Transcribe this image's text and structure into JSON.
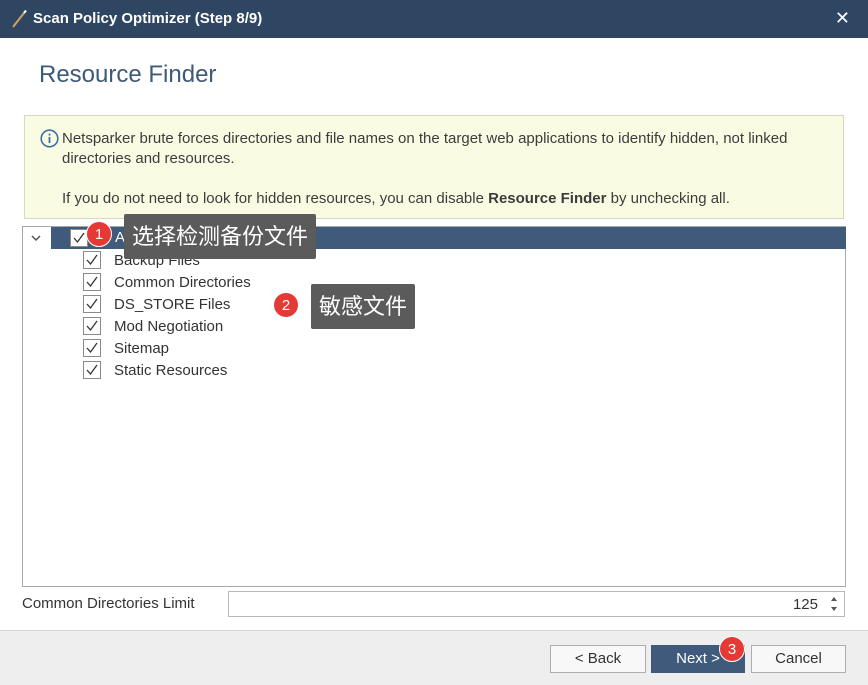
{
  "window": {
    "title": "Scan Policy Optimizer (Step 8/9)",
    "close_glyph": "✕"
  },
  "page": {
    "heading": "Resource Finder"
  },
  "info": {
    "icon": "info-icon",
    "line1": "Netsparker brute forces directories and file names on the target web applications to identify hidden, not linked directories and resources.",
    "line2_prefix": "If you do not need to look for hidden resources, you can disable ",
    "line2_bold": "Resource Finder",
    "line2_suffix": " by unchecking all."
  },
  "tree": {
    "root": {
      "label": "All",
      "checked": true
    },
    "items": [
      {
        "label": "Backup Files",
        "checked": true
      },
      {
        "label": "Common Directories",
        "checked": true
      },
      {
        "label": "DS_STORE Files",
        "checked": true
      },
      {
        "label": "Mod Negotiation",
        "checked": true
      },
      {
        "label": "Sitemap",
        "checked": true
      },
      {
        "label": "Static Resources",
        "checked": true
      }
    ]
  },
  "annotations": [
    {
      "badge": "1",
      "text": "选择检测备份文件"
    },
    {
      "badge": "2",
      "text": "敏感文件"
    },
    {
      "badge": "3"
    }
  ],
  "limit": {
    "label": "Common Directories Limit",
    "value": "125"
  },
  "buttons": {
    "back_label": "< Back",
    "next_label": "Next >",
    "cancel_label": "Cancel"
  },
  "colors": {
    "titlebar": "#2f4663",
    "accent": "#3f5a7a",
    "info_bg": "#fafbe3",
    "badge": "#e53935"
  }
}
